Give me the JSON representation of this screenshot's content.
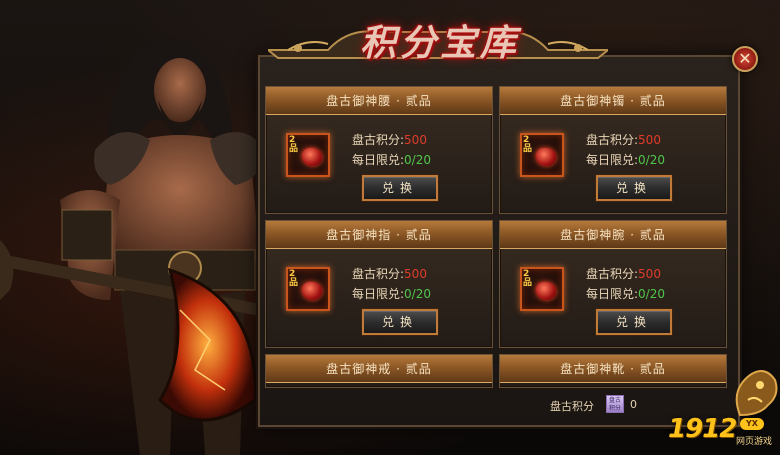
{
  "title": "积分宝库",
  "close_label": "✕",
  "cards": [
    {
      "name": "盘古御神腰 · 贰品",
      "grade": "2品",
      "points_label": "盘古积分:",
      "points_value": "500",
      "limit_label": "每日限兑:",
      "limit_value": "0/20",
      "button": "兑换"
    },
    {
      "name": "盘古御神镯 · 贰品",
      "grade": "2品",
      "points_label": "盘古积分:",
      "points_value": "500",
      "limit_label": "每日限兑:",
      "limit_value": "0/20",
      "button": "兑换"
    },
    {
      "name": "盘古御神指 · 贰品",
      "grade": "2品",
      "points_label": "盘古积分:",
      "points_value": "500",
      "limit_label": "每日限兑:",
      "limit_value": "0/20",
      "button": "兑换"
    },
    {
      "name": "盘古御神腕 · 贰品",
      "grade": "2品",
      "points_label": "盘古积分:",
      "points_value": "500",
      "limit_label": "每日限兑:",
      "limit_value": "0/20",
      "button": "兑换"
    },
    {
      "name": "盘古御神戒 · 贰品"
    },
    {
      "name": "盘古御神靴 · 贰品"
    }
  ],
  "footer": {
    "label": "盘古积分",
    "coin_text": "盘古积分",
    "value": "0"
  },
  "brand": {
    "number": "1912",
    "badge": "YX",
    "subtitle": "网页游戏"
  },
  "colors": {
    "accent_red": "#e03b2a",
    "accent_green": "#4fc64a",
    "gold": "#c07a3a"
  }
}
